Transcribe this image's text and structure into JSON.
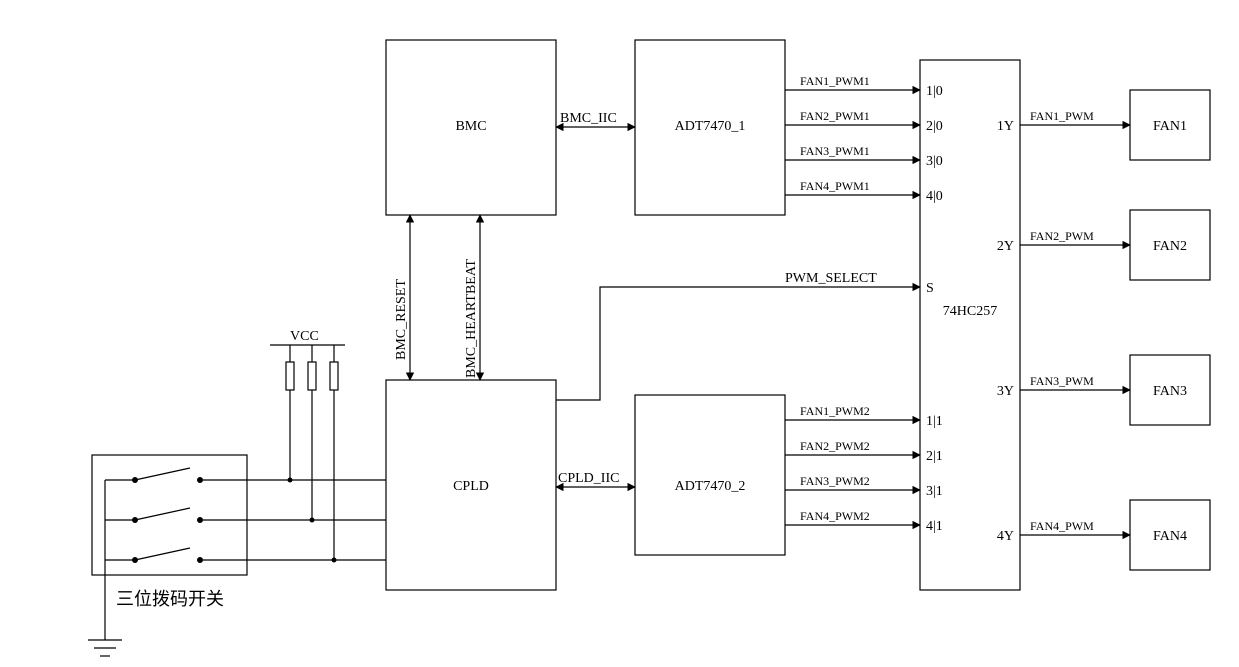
{
  "blocks": {
    "bmc": "BMC",
    "cpld": "CPLD",
    "adt1": "ADT7470_1",
    "adt2": "ADT7470_2",
    "mux": "74HC257",
    "fan1": "FAN1",
    "fan2": "FAN2",
    "fan3": "FAN3",
    "fan4": "FAN4",
    "switch_label": "三位拨码开关"
  },
  "signals": {
    "bmc_iic": "BMC_IIC",
    "cpld_iic": "CPLD_IIC",
    "bmc_reset": "BMC_RESET",
    "bmc_heartbeat": "BMC_HEARTBEAT",
    "pwm_select": "PWM_SELECT",
    "vcc": "VCC",
    "fan1_pwm1": "FAN1_PWM1",
    "fan2_pwm1": "FAN2_PWM1",
    "fan3_pwm1": "FAN3_PWM1",
    "fan4_pwm1": "FAN4_PWM1",
    "fan1_pwm2": "FAN1_PWM2",
    "fan2_pwm2": "FAN2_PWM2",
    "fan3_pwm2": "FAN3_PWM2",
    "fan4_pwm2": "FAN4_PWM2",
    "fan1_pwm": "FAN1_PWM",
    "fan2_pwm": "FAN2_PWM",
    "fan3_pwm": "FAN3_PWM",
    "fan4_pwm": "FAN4_PWM"
  },
  "mux_pins": {
    "i10": "1|0",
    "i20": "2|0",
    "i30": "3|0",
    "i40": "4|0",
    "i11": "1|1",
    "i21": "2|1",
    "i31": "3|1",
    "i41": "4|1",
    "s": "S",
    "y1": "1Y",
    "y2": "2Y",
    "y3": "3Y",
    "y4": "4Y"
  }
}
